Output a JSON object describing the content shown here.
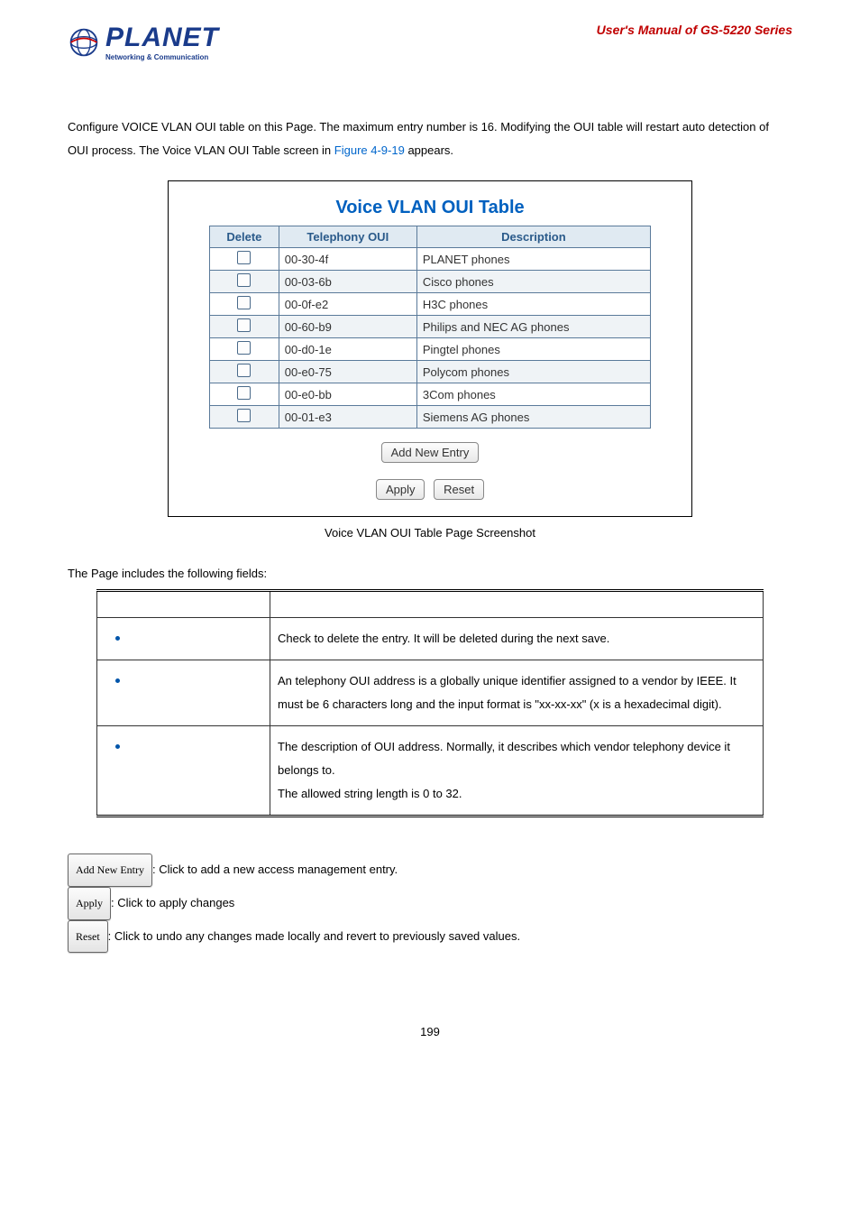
{
  "header": {
    "logo_main": "PLANET",
    "logo_sub": "Networking & Communication",
    "manual_title": "User's  Manual  of  GS-5220 Series"
  },
  "intro_part1": "Configure VOICE VLAN OUI table on this Page. The maximum entry number is 16. Modifying the OUI table will restart auto detection of OUI process. The Voice VLAN OUI Table screen in ",
  "intro_figure": "Figure 4-9-19",
  "intro_part2": " appears.",
  "screenshot": {
    "title": "Voice VLAN OUI Table",
    "headers": {
      "delete": "Delete",
      "oui": "Telephony OUI",
      "desc": "Description"
    },
    "rows": [
      {
        "oui": "00-30-4f",
        "desc": "PLANET phones"
      },
      {
        "oui": "00-03-6b",
        "desc": "Cisco phones"
      },
      {
        "oui": "00-0f-e2",
        "desc": "H3C phones"
      },
      {
        "oui": "00-60-b9",
        "desc": "Philips and NEC AG phones"
      },
      {
        "oui": "00-d0-1e",
        "desc": "Pingtel phones"
      },
      {
        "oui": "00-e0-75",
        "desc": "Polycom phones"
      },
      {
        "oui": "00-e0-bb",
        "desc": "3Com phones"
      },
      {
        "oui": "00-01-e3",
        "desc": "Siemens AG phones"
      }
    ],
    "btn_add": "Add New Entry",
    "btn_apply": "Apply",
    "btn_reset": "Reset"
  },
  "caption": "Voice VLAN OUI Table Page Screenshot",
  "fields_intro": "The Page includes the following fields:",
  "fields": [
    {
      "desc": "Check to delete the entry. It will be deleted during the next save."
    },
    {
      "desc": "An telephony OUI address is a globally unique identifier assigned to a vendor by IEEE. It must be 6 characters long and the input format is \"xx-xx-xx\" (x is a hexadecimal digit)."
    },
    {
      "desc": "The description of OUI address. Normally, it describes which vendor telephony device it belongs to.",
      "extra": "The allowed string length is 0 to 32."
    }
  ],
  "buttons": {
    "add": {
      "label": "Add New Entry",
      "desc": ": Click to add a new access management entry."
    },
    "apply": {
      "label": "Apply",
      "desc": ": Click to apply changes"
    },
    "reset": {
      "label": "Reset",
      "desc": ": Click to undo any changes made locally and revert to previously saved values."
    }
  },
  "page_num": "199"
}
